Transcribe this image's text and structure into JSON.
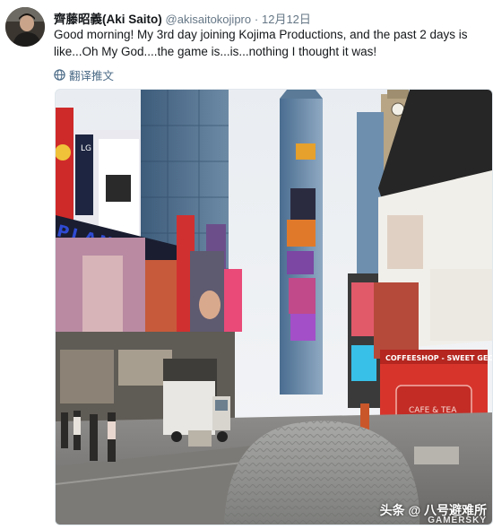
{
  "tweet": {
    "display_name": "齊藤昭義(Aki Saito)",
    "handle": "@akisaitokojipro",
    "separator": "·",
    "date": "12月12日",
    "text": "Good morning! My 3rd day joining Kojima Productions, and the past 2 days is like...Oh My God....the game is...is...nothing I thought it was!",
    "translate_label": "翻译推文"
  },
  "photo": {
    "signs": {
      "coffee_sign": "COFFEESHOP - SWEET GEORGE",
      "cafe_label": "CAFE & TEA",
      "led_letters": "PLANET",
      "lg_logo": "LG"
    }
  },
  "watermark": {
    "text": "头条 @ 八号避难所",
    "brand": "GAMERSKY"
  },
  "colors": {
    "link_gray": "#657786",
    "translate_blue": "#4a6a86"
  }
}
